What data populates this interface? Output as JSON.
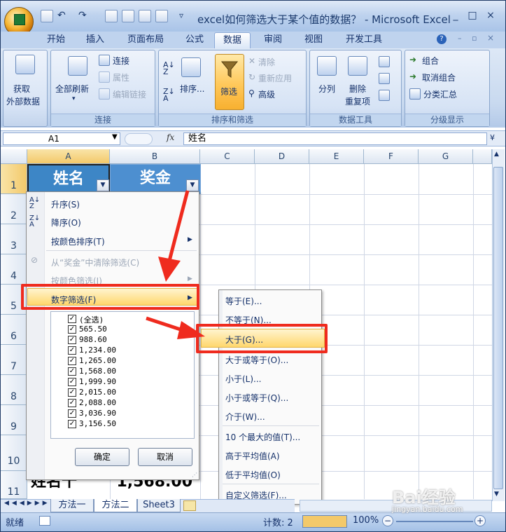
{
  "window": {
    "title": "excel如何筛选大于某个值的数据？ - Microsoft Excel",
    "buttons": [
      "_",
      "□",
      "×"
    ]
  },
  "ribbon_tabs": [
    {
      "label": "开始"
    },
    {
      "label": "插入"
    },
    {
      "label": "页面布局"
    },
    {
      "label": "公式"
    },
    {
      "label": "数据",
      "active": true
    },
    {
      "label": "审阅"
    },
    {
      "label": "视图"
    },
    {
      "label": "开发工具"
    }
  ],
  "ribbon": {
    "get_external": {
      "line1": "获取",
      "line2": "外部数据"
    },
    "connections": {
      "refresh_all": "全部刷新",
      "connect": "连接",
      "properties": "属性",
      "edit_links": "编辑链接",
      "group_label": "连接"
    },
    "sort_filter": {
      "sort": "排序...",
      "filter": "筛选",
      "clear": "清除",
      "reapply": "重新应用",
      "advanced": "高级",
      "group_label": "排序和筛选"
    },
    "data_tools": {
      "text_to_columns": "分列",
      "remove_dup_1": "删除",
      "remove_dup_2": "重复项",
      "group_label": "数据工具"
    },
    "outline": {
      "group": "组合",
      "ungroup": "取消组合",
      "subtotal": "分类汇总",
      "group_label": "分级显示"
    }
  },
  "formula_bar": {
    "name_box": "A1",
    "fx": "fx",
    "content": "姓名"
  },
  "columns": [
    "A",
    "B",
    "C",
    "D",
    "E",
    "F",
    "G"
  ],
  "rows": [
    "1",
    "2",
    "3",
    "4",
    "5",
    "6",
    "7",
    "8",
    "9",
    "10",
    "11"
  ],
  "cells": {
    "A1": "姓名",
    "B1": "奖金",
    "A11": "姓名十",
    "B11": "1,568.00"
  },
  "filter_menu": {
    "sort_asc": "升序(S)",
    "sort_desc": "降序(O)",
    "sort_by_color": "按颜色排序(T)",
    "clear_filter": "从“奖金”中清除筛选(C)",
    "filter_by_color": "按颜色筛选(I)",
    "number_filter": "数字筛选(F)",
    "values": [
      "(全选)",
      "565.50",
      "988.60",
      "1,234.00",
      "1,265.00",
      "1,568.00",
      "1,999.90",
      "2,015.00",
      "2,088.00",
      "3,036.90",
      "3,156.50"
    ],
    "ok": "确定",
    "cancel": "取消"
  },
  "number_filter_menu": [
    "等于(E)...",
    "不等于(N)...",
    "大于(G)...",
    "大于或等于(O)...",
    "小于(L)...",
    "小于或等于(Q)...",
    "介于(W)...",
    "10 个最大的值(T)...",
    "高于平均值(A)",
    "低于平均值(O)",
    "自定义筛选(F)..."
  ],
  "sheet_tabs": [
    "方法一",
    "方法二",
    "Sheet3"
  ],
  "status": {
    "ready": "就绪",
    "count": "计数: 2",
    "zoom": "100%"
  },
  "watermark": {
    "brand": "Bai经验",
    "url": "jingyan.baidu.com"
  },
  "colors": {
    "header_blue": "#3d86c6",
    "highlight": "#ffd76d",
    "callout_red": "#ef2b1e"
  }
}
